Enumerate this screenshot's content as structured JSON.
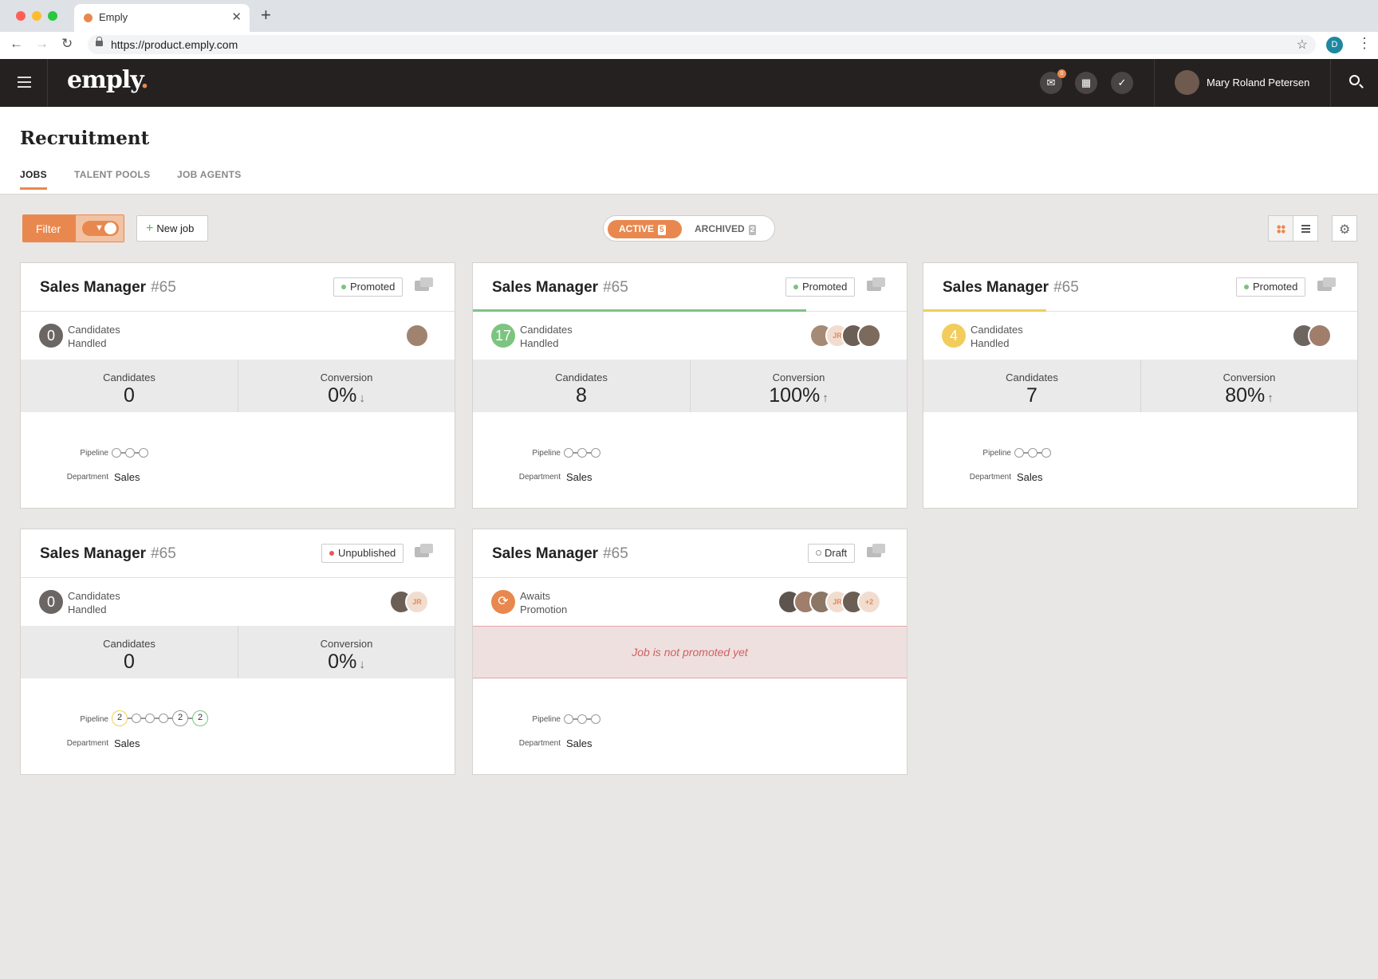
{
  "browser": {
    "tab_title": "Emply",
    "url": "https://product.emply.com",
    "profile_initial": "D"
  },
  "app": {
    "logo": "emply",
    "logo_dot": ".",
    "mail_badge": "0",
    "user_name": "Mary Roland Petersen"
  },
  "page": {
    "title": "Recruitment",
    "tabs": [
      "JOBS",
      "TALENT POOLS",
      "JOB AGENTS"
    ]
  },
  "toolbar": {
    "filter_label": "Filter",
    "new_job_label": "New job",
    "active_label": "ACTIVE",
    "active_count": "5",
    "archived_label": "ARCHIVED",
    "archived_count": "2"
  },
  "labels": {
    "candidates": "Candidates",
    "conversion": "Conversion",
    "pipeline": "Pipeline",
    "department": "Department"
  },
  "cards": [
    {
      "title": "Sales Manager",
      "number": "#65",
      "status": "Promoted",
      "handled_count": "0",
      "handled_line1": "Candidates",
      "handled_line2": "Handled",
      "candidates": "0",
      "conversion": "0%",
      "trend": "↓",
      "department": "Sales",
      "color": "#6b6664"
    },
    {
      "title": "Sales Manager",
      "number": "#65",
      "status": "Promoted",
      "handled_count": "17",
      "handled_line1": "Candidates",
      "handled_line2": "Handled",
      "candidates": "8",
      "conversion": "100%",
      "trend": "↑",
      "department": "Sales",
      "color": "#7cc47f"
    },
    {
      "title": "Sales Manager",
      "number": "#65",
      "status": "Promoted",
      "handled_count": "4",
      "handled_line1": "Candidates",
      "handled_line2": "Handled",
      "candidates": "7",
      "conversion": "80%",
      "trend": "↑",
      "department": "Sales",
      "color": "#f2cc5c"
    },
    {
      "title": "Sales Manager",
      "number": "#65",
      "status": "Unpublished",
      "handled_count": "0",
      "handled_line1": "Candidates",
      "handled_line2": "Handled",
      "candidates": "0",
      "conversion": "0%",
      "trend": "↓",
      "department": "Sales",
      "pipeline_counts": [
        "2",
        "2",
        "2"
      ],
      "color": "#6b6664"
    },
    {
      "title": "Sales Manager",
      "number": "#65",
      "status": "Draft",
      "handled_line1": "Awaits",
      "handled_line2": "Promotion",
      "message": "Job is not promoted yet",
      "department": "Sales",
      "color": "#e8884e"
    }
  ],
  "avatar_labels": {
    "jr": "JR",
    "more": "+2"
  },
  "colors": {
    "accent": "#e8884e",
    "topbar": "#252120",
    "promoted": "#7cc47f",
    "unpublished": "#e05a5a"
  }
}
